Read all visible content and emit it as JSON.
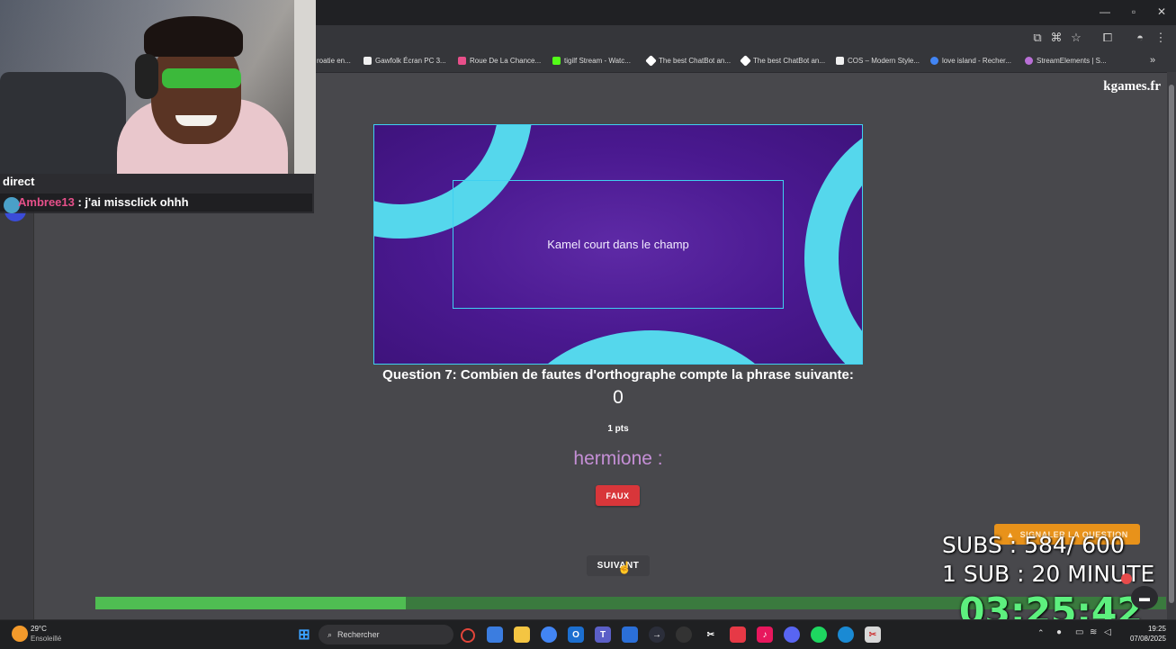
{
  "site_brand": "kgames.fr",
  "bookmarks": [
    {
      "label": "roatie en...",
      "color": "#555"
    },
    {
      "label": "Gawfolk Écran PC 3...",
      "color": "#f0f0f0"
    },
    {
      "label": "Roue De La Chance...",
      "color": "#e84f8a"
    },
    {
      "label": "tigilf Stream - Watc...",
      "color": "#53fc18"
    },
    {
      "label": "The best ChatBot an...",
      "color": "#ffffff"
    },
    {
      "label": "The best ChatBot an...",
      "color": "#ffffff"
    },
    {
      "label": "COS – Modern Style...",
      "color": "#f0f0f0"
    },
    {
      "label": "love island - Recher...",
      "color": "#4285f4"
    },
    {
      "label": "StreamElements | S...",
      "color": "#b96fd6"
    }
  ],
  "chat": {
    "header": "direct",
    "username": "Ambree13",
    "message": " : j'ai missclick ohhh"
  },
  "quiz": {
    "sentence": "Kamel court dans le champ",
    "question": "Question 7: Combien de fautes d'orthographe compte la phrase suivante:",
    "answer": "0",
    "points": "1 pts",
    "player": "hermione :",
    "result_label": "FAUX",
    "next_label": "SUIVANT",
    "report_label": "SIGNALER LA QUESTION",
    "progress": 0.29
  },
  "stream_overlay": {
    "subs": "SUBS : 584/ 600",
    "rule": "1 SUB :  20 MINUTE",
    "timer": "03:25:42"
  },
  "taskbar": {
    "weather_temp": "29°C",
    "weather_desc": "Ensoleillé",
    "search_placeholder": "Rechercher",
    "time": "19:25",
    "date": "07/08/2025"
  },
  "colors": {
    "accent_cyan": "#3fd0f0",
    "card_purple": "#4a1990",
    "faux_red": "#d8363a",
    "report_orange": "#e8921a",
    "progress_green": "#4fbd52",
    "player_lilac": "#c58fd6",
    "timer_green": "#5df07e"
  }
}
